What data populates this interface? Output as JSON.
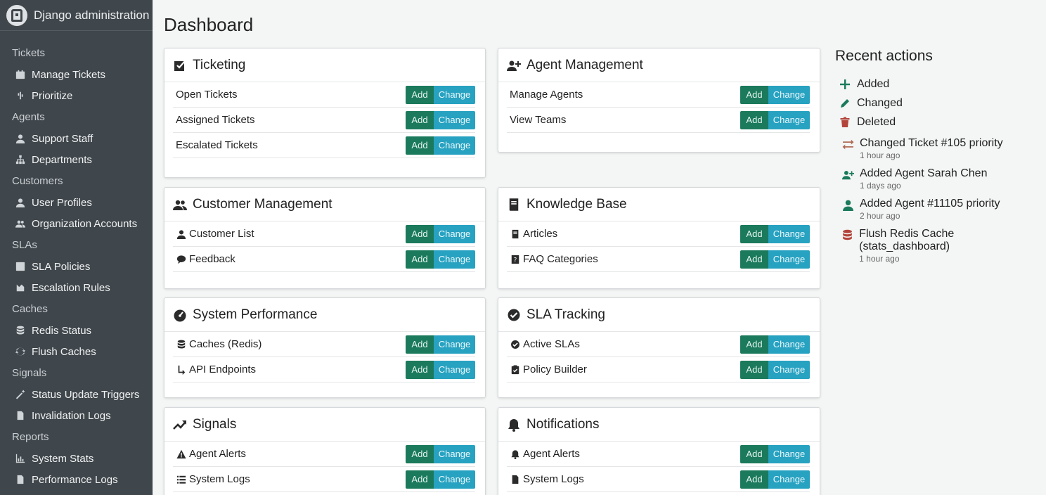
{
  "app": {
    "title": "Django administration"
  },
  "sidebar": {
    "groups": [
      {
        "label": "Tickets",
        "items": [
          {
            "label": "Manage Tickets",
            "icon": "calendar-icon"
          },
          {
            "label": "Prioritize",
            "icon": "priority-icon"
          }
        ]
      },
      {
        "label": "Agents",
        "items": [
          {
            "label": "Support Staff",
            "icon": "user-icon"
          },
          {
            "label": "Departments",
            "icon": "sitemap-icon"
          }
        ]
      },
      {
        "label": "Customers",
        "items": [
          {
            "label": "User Profiles",
            "icon": "user-icon"
          },
          {
            "label": "Organization Accounts",
            "icon": "users-icon"
          }
        ]
      },
      {
        "label": "SLAs",
        "items": [
          {
            "label": "SLA Policies",
            "icon": "edit-icon"
          },
          {
            "label": "Escalation Rules",
            "icon": "escalation-icon"
          }
        ]
      },
      {
        "label": "Caches",
        "items": [
          {
            "label": "Redis Status",
            "icon": "database-icon"
          },
          {
            "label": "Flush Caches",
            "icon": "refresh-icon"
          }
        ]
      },
      {
        "label": "Signals",
        "items": [
          {
            "label": "Status Update Triggers",
            "icon": "wand-icon"
          },
          {
            "label": "Invalidation Logs",
            "icon": "file-icon"
          }
        ]
      },
      {
        "label": "Reports",
        "items": [
          {
            "label": "System Stats",
            "icon": "chart-icon"
          },
          {
            "label": "Performance Logs",
            "icon": "file-icon"
          }
        ]
      }
    ]
  },
  "main": {
    "title": "Dashboard",
    "add_label": "Add",
    "change_label": "Change",
    "modules": [
      {
        "title": "Ticketing",
        "icon": "check-square-icon",
        "rows": [
          {
            "label": "Open Tickets",
            "icon": ""
          },
          {
            "label": "Assigned Tickets",
            "icon": ""
          },
          {
            "label": "Escalated Tickets",
            "icon": ""
          }
        ]
      },
      {
        "title": "Agent Management",
        "icon": "user-plus-icon",
        "rows": [
          {
            "label": "Manage Agents",
            "icon": ""
          },
          {
            "label": "View Teams",
            "icon": ""
          }
        ]
      },
      {
        "title": "Customer Management",
        "icon": "users-icon",
        "rows": [
          {
            "label": "Customer List",
            "icon": "user-icon"
          },
          {
            "label": "Feedback",
            "icon": "comment-icon"
          }
        ]
      },
      {
        "title": "Knowledge Base",
        "icon": "book-icon",
        "rows": [
          {
            "label": "Articles",
            "icon": "book-icon"
          },
          {
            "label": "FAQ Categories",
            "icon": "question-book-icon"
          }
        ]
      },
      {
        "title": "System Performance",
        "icon": "gauge-icon",
        "rows": [
          {
            "label": "Caches (Redis)",
            "icon": "database-icon"
          },
          {
            "label": "API Endpoints",
            "icon": "branch-icon"
          }
        ]
      },
      {
        "title": "SLA Tracking",
        "icon": "check-circle-icon",
        "rows": [
          {
            "label": "Active SLAs",
            "icon": "check-circle-icon"
          },
          {
            "label": "Policy Builder",
            "icon": "clipboard-icon"
          }
        ]
      },
      {
        "title": "Signals",
        "icon": "trend-icon",
        "rows": [
          {
            "label": "Agent Alerts",
            "icon": "warning-icon"
          },
          {
            "label": "System Logs",
            "icon": "list-icon"
          }
        ]
      },
      {
        "title": "Notifications",
        "icon": "bell-icon",
        "rows": [
          {
            "label": "Agent Alerts",
            "icon": "bell-icon"
          },
          {
            "label": "System Logs",
            "icon": "file-icon"
          }
        ]
      }
    ]
  },
  "recent": {
    "title": "Recent actions",
    "legend": [
      {
        "label": "Added",
        "icon": "plus-icon",
        "color": "#1b7a5c"
      },
      {
        "label": "Changed",
        "icon": "pencil-icon",
        "color": "#1b7a5c"
      },
      {
        "label": "Deleted",
        "icon": "trash-icon",
        "color": "#b3443a"
      }
    ],
    "items": [
      {
        "text": "Changed Ticket #105 priority",
        "time": "1 hour ago",
        "icon": "exchange-icon",
        "color": "#b06a55"
      },
      {
        "text": "Added Agent Sarah Chen",
        "time": "1 days ago",
        "icon": "user-plus-icon",
        "color": "#1b7a5c"
      },
      {
        "text": "Added Agent #11105 priority",
        "time": "2 hour ago",
        "icon": "user-icon",
        "color": "#1b7a5c"
      },
      {
        "text": "Flush Redis Cache (stats_dashboard)",
        "time": "1 hour ago",
        "icon": "database-icon",
        "color": "#b3443a"
      }
    ]
  },
  "colors": {
    "sidebar_bg": "#40474c",
    "add_button": "#1b7a5c",
    "change_button": "#27a2c1",
    "page_bg": "#f4f5f5"
  }
}
